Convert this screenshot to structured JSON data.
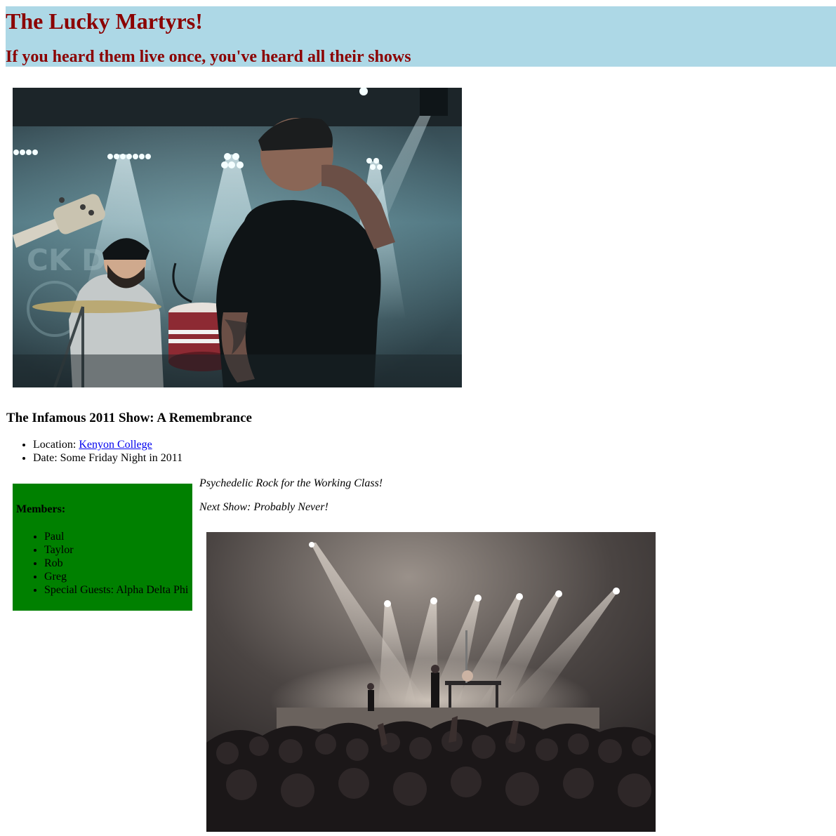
{
  "header": {
    "title": "The Lucky Martyrs!",
    "tagline": "If you heard them live once, you've heard all their shows",
    "background_color": "#add8e6",
    "text_color": "#8b0000"
  },
  "images": {
    "band": {
      "subject": "band performing on stage under blue stage lights"
    },
    "crowd": {
      "subject": "concert crowd facing a lit stage"
    }
  },
  "show": {
    "heading": "The Infamous 2011 Show: A Remembrance",
    "location_label": "Location: ",
    "location_link": "Kenyon College",
    "date_text": "Date: Some Friday Night in 2011"
  },
  "members": {
    "title": "Members:",
    "items": [
      "Paul",
      "Taylor",
      "Rob",
      "Greg",
      "Special Guests: Alpha Delta Phi"
    ],
    "box_color": "#008000"
  },
  "taglines": {
    "genre": "Psychedelic Rock for the Working Class!",
    "next_show": "Next Show: Probably Never!"
  },
  "colors": {
    "link": "#0000ee"
  }
}
